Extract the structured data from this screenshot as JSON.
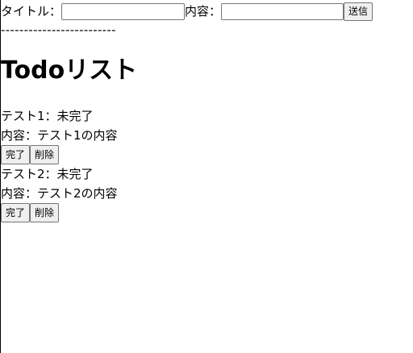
{
  "form": {
    "title_label": "タイトル：",
    "title_value": "",
    "content_label": "内容：",
    "content_value": "",
    "submit_label": "送信"
  },
  "divider": "-------------------------",
  "heading": "Todoリスト",
  "todos": [
    {
      "status_line": "テスト1：未完了",
      "content_line": "内容：テスト1の内容",
      "complete_label": "完了",
      "delete_label": "削除"
    },
    {
      "status_line": "テスト2：未完了",
      "content_line": "内容：テスト2の内容",
      "complete_label": "完了",
      "delete_label": "削除"
    }
  ]
}
